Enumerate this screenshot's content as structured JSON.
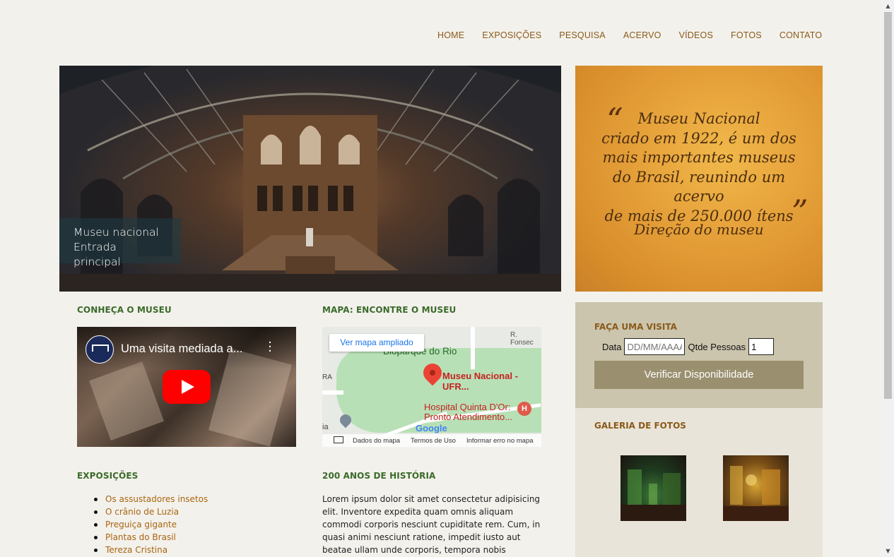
{
  "nav": {
    "items": [
      "HOME",
      "EXPOSIÇÕES",
      "PESQUISA",
      "ACERVO",
      "VÍDEOS",
      "FOTOS",
      "CONTATO"
    ]
  },
  "hero": {
    "caption_line1": "Museu nacional",
    "caption_line2": "Entrada principal"
  },
  "quote": {
    "open_mark": "“",
    "close_mark": "”",
    "lines": [
      "Museu Nacional",
      "criado em 1922, é um dos",
      "mais importantes museus",
      "do Brasil, reunindo um acervo",
      "de mais de 250.000 ítens"
    ],
    "author": "Direção do museu"
  },
  "sections": {
    "conheca": "CONHEÇA O MUSEU",
    "mapa": "MAPA: ENCONTRE O MUSEU",
    "exposicoes": "EXPOSIÇÕES",
    "historia": "200 ANOS DE HISTÓRIA"
  },
  "video": {
    "title": "Uma visita mediada a...",
    "channel_logo": "museu-nacional-logo",
    "play_icon": "youtube-play-icon"
  },
  "map": {
    "ampliado": "Ver mapa ampliado",
    "park_label": "Bioparque do Rio",
    "museum_label": "Museu Nacional - UFR...",
    "hospital_line1": "Hospital Quinta D'Or:",
    "hospital_line2": "Pronto Atendimento...",
    "street_label": "R. Fonsec",
    "side_label_1": "RA",
    "side_label_2": "ia",
    "google": "Google",
    "footer_data": "Dados do mapa",
    "footer_terms": "Termos de Uso",
    "footer_report": "Informar erro no mapa"
  },
  "exhibitions": [
    "Os assustadores insetos",
    "O crânio de Luzia",
    "Preguiça gigante",
    "Plantas do Brasil",
    "Tereza Cristina"
  ],
  "history": {
    "text": "Lorem ipsum dolor sit amet consectetur adipisicing elit. Inventore expedita quam omnis aliquam commodi corporis nesciunt cupiditate rem. Cum, in quasi animi nesciunt ratione, impedit iusto aut beatae ullam unde corporis, tempora nobis"
  },
  "visit": {
    "title": "FAÇA UMA VISITA",
    "date_label": "Data",
    "date_placeholder": "DD/MM/AAAA",
    "people_label": "Qtde Pessoas",
    "people_value": "1",
    "button": "Verificar Disponibilidade"
  },
  "gallery": {
    "title": "GALERIA DE FOTOS"
  },
  "colors": {
    "nav_text": "#8a5a1a",
    "section_green": "#3a6b2a",
    "link_orange": "#a8650f",
    "visit_bg": "#cbc5ad",
    "button_bg": "#9a8f6e"
  }
}
